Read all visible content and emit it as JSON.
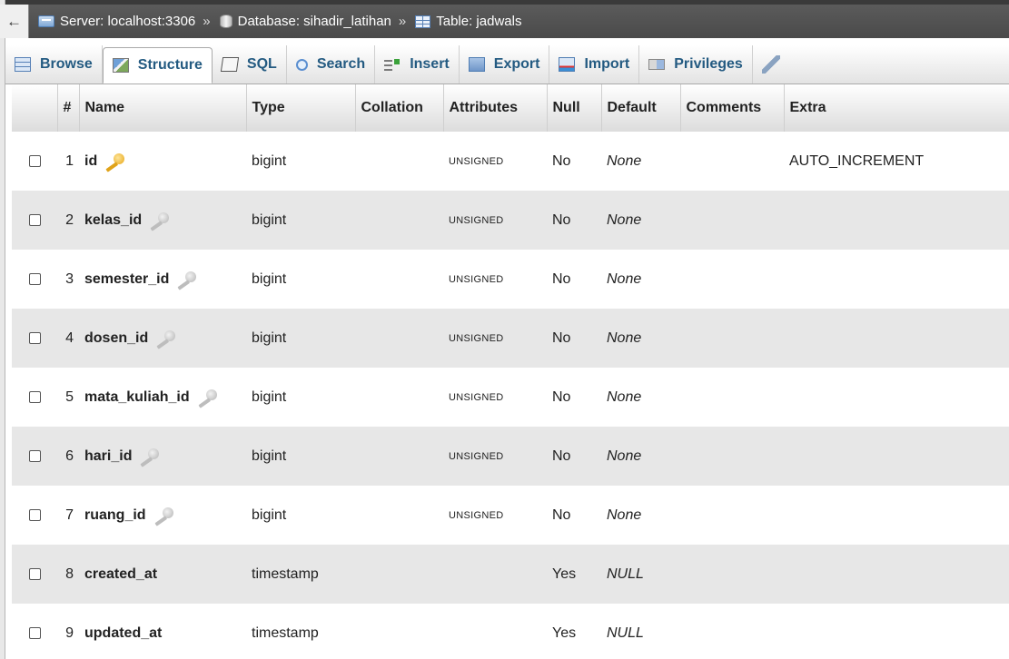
{
  "breadcrumb": {
    "back_label": "←",
    "separator": "»",
    "server": "Server: localhost:3306",
    "database": "Database: sihadir_latihan",
    "table": "Table: jadwals"
  },
  "tabs": [
    {
      "label": "Browse",
      "icon": "browse-icon"
    },
    {
      "label": "Structure",
      "icon": "structure-icon",
      "active": true
    },
    {
      "label": "SQL",
      "icon": "sql-icon"
    },
    {
      "label": "Search",
      "icon": "search-icon"
    },
    {
      "label": "Insert",
      "icon": "insert-icon"
    },
    {
      "label": "Export",
      "icon": "export-icon"
    },
    {
      "label": "Import",
      "icon": "import-icon"
    },
    {
      "label": "Privileges",
      "icon": "privileges-icon"
    },
    {
      "label": "",
      "icon": "wrench-icon"
    }
  ],
  "columns": [
    "#",
    "Name",
    "Type",
    "Collation",
    "Attributes",
    "Null",
    "Default",
    "Comments",
    "Extra"
  ],
  "rows": [
    {
      "num": "1",
      "name": "id",
      "key": "primary",
      "type": "bigint",
      "collation": "",
      "attributes": "UNSIGNED",
      "null": "No",
      "default": "None",
      "comments": "",
      "extra": "AUTO_INCREMENT"
    },
    {
      "num": "2",
      "name": "kelas_id",
      "key": "index",
      "type": "bigint",
      "collation": "",
      "attributes": "UNSIGNED",
      "null": "No",
      "default": "None",
      "comments": "",
      "extra": ""
    },
    {
      "num": "3",
      "name": "semester_id",
      "key": "index",
      "type": "bigint",
      "collation": "",
      "attributes": "UNSIGNED",
      "null": "No",
      "default": "None",
      "comments": "",
      "extra": ""
    },
    {
      "num": "4",
      "name": "dosen_id",
      "key": "index",
      "type": "bigint",
      "collation": "",
      "attributes": "UNSIGNED",
      "null": "No",
      "default": "None",
      "comments": "",
      "extra": ""
    },
    {
      "num": "5",
      "name": "mata_kuliah_id",
      "key": "index",
      "type": "bigint",
      "collation": "",
      "attributes": "UNSIGNED",
      "null": "No",
      "default": "None",
      "comments": "",
      "extra": ""
    },
    {
      "num": "6",
      "name": "hari_id",
      "key": "index",
      "type": "bigint",
      "collation": "",
      "attributes": "UNSIGNED",
      "null": "No",
      "default": "None",
      "comments": "",
      "extra": ""
    },
    {
      "num": "7",
      "name": "ruang_id",
      "key": "index",
      "type": "bigint",
      "collation": "",
      "attributes": "UNSIGNED",
      "null": "No",
      "default": "None",
      "comments": "",
      "extra": ""
    },
    {
      "num": "8",
      "name": "created_at",
      "key": "",
      "type": "timestamp",
      "collation": "",
      "attributes": "",
      "null": "Yes",
      "default": "NULL",
      "comments": "",
      "extra": ""
    },
    {
      "num": "9",
      "name": "updated_at",
      "key": "",
      "type": "timestamp",
      "collation": "",
      "attributes": "",
      "null": "Yes",
      "default": "NULL",
      "comments": "",
      "extra": ""
    }
  ]
}
